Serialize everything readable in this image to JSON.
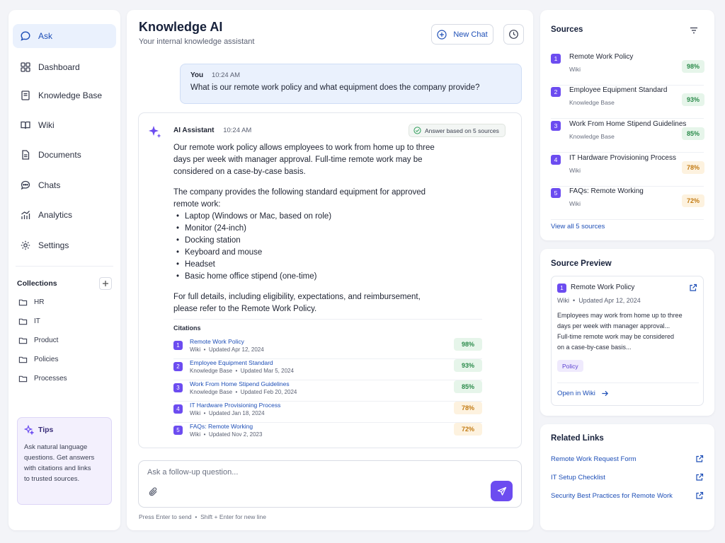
{
  "sidebar": {
    "nav": [
      {
        "label": "Ask",
        "icon": "chat-bubble-icon"
      },
      {
        "label": "Dashboard",
        "icon": "dashboard-icon"
      },
      {
        "label": "Knowledge Base",
        "icon": "book-icon"
      },
      {
        "label": "Wiki",
        "icon": "open-book-icon"
      },
      {
        "label": "Documents",
        "icon": "document-icon"
      },
      {
        "label": "Chats",
        "icon": "chat-icon"
      },
      {
        "label": "Analytics",
        "icon": "analytics-icon"
      },
      {
        "label": "Settings",
        "icon": "gear-icon"
      }
    ],
    "active_item": "Ask",
    "collections_title": "Collections",
    "collections": [
      "HR",
      "IT",
      "Product",
      "Policies",
      "Processes"
    ],
    "tips": {
      "title": "Tips",
      "line1": "Ask natural language",
      "line2": "questions. Get answers",
      "line3": "with citations and links",
      "line4": "to trusted sources."
    }
  },
  "header": {
    "title": "Knowledge AI",
    "subtitle": "Your internal knowledge assistant",
    "new_chat_label": "New Chat"
  },
  "user_message": {
    "author": "You",
    "time": "10:24 AM",
    "text": "What is our remote work policy and what equipment does the company provide?"
  },
  "ai_message": {
    "author": "AI Assistant",
    "time": "10:24 AM",
    "badge": "Answer based on 5 sources",
    "p1_l1": "Our remote work policy allows employees to work from home up to three",
    "p1_l2": "days per week with manager approval. Full-time remote work may be",
    "p1_l3": "considered on a case-by-case basis.",
    "p2_l1": "The company provides the following standard equipment for approved",
    "p2_l2": "remote work:",
    "equipment": [
      "Laptop (Windows or Mac, based on role)",
      "Monitor (24-inch)",
      "Docking station",
      "Keyboard and mouse",
      "Headset",
      "Basic home office stipend (one-time)"
    ],
    "p3_l1": "For full details, including eligibility, expectations, and reimbursement,",
    "p3_l2": "please refer to the Remote Work Policy.",
    "citations_title": "Citations",
    "citations": [
      {
        "num": "1",
        "title": "Remote Work Policy",
        "source": "Wiki",
        "updated": "Updated Apr 12, 2024",
        "score": "98%"
      },
      {
        "num": "2",
        "title": "Employee Equipment Standard",
        "source": "Knowledge Base",
        "updated": "Updated Mar 5, 2024",
        "score": "93%"
      },
      {
        "num": "3",
        "title": "Work From Home Stipend Guidelines",
        "source": "Knowledge Base",
        "updated": "Updated Feb 20, 2024",
        "score": "85%"
      },
      {
        "num": "4",
        "title": "IT Hardware Provisioning Process",
        "source": "Wiki",
        "updated": "Updated Jan 18, 2024",
        "score": "78%"
      },
      {
        "num": "5",
        "title": "FAQs: Remote Working",
        "source": "Wiki",
        "updated": "Updated Nov 2, 2023",
        "score": "72%"
      }
    ],
    "bullet_sep": "•"
  },
  "composer": {
    "placeholder": "Ask a follow-up question...",
    "hint_key1": "Press Enter",
    "hint_text1": "to send",
    "hint_key2": "Shift + Enter",
    "hint_text2": "for new line"
  },
  "sources_panel": {
    "title": "Sources",
    "items": [
      {
        "num": "1",
        "title": "Remote Work Policy",
        "source": "Wiki",
        "score": "98%"
      },
      {
        "num": "2",
        "title": "Employee Equipment Standard",
        "source": "Knowledge Base",
        "score": "93%"
      },
      {
        "num": "3",
        "title": "Work From Home Stipend Guidelines",
        "source": "Knowledge Base",
        "score": "85%"
      },
      {
        "num": "4",
        "title": "IT Hardware Provisioning Process",
        "source": "Wiki",
        "score": "78%"
      },
      {
        "num": "5",
        "title": "FAQs: Remote Working",
        "source": "Wiki",
        "score": "72%"
      }
    ],
    "view_all": "View all 5 sources"
  },
  "preview_panel": {
    "title": "Source Preview",
    "num": "1",
    "doc_title": "Remote Work Policy",
    "source": "Wiki",
    "updated": "Updated Apr 12, 2024",
    "l1": "Employees may work from home up to three",
    "l2": "days per week with manager approval...",
    "l3": "Full-time remote work may be considered",
    "l4": "on a case-by-case basis...",
    "tag": "Policy",
    "open_label": "Open in Wiki"
  },
  "related_panel": {
    "title": "Related Links",
    "links": [
      "Remote Work Request Form",
      "IT Setup Checklist",
      "Security Best Practices for Remote Work"
    ]
  },
  "colors": {
    "accent_purple": "#6c4cf0",
    "link_blue": "#1e4fb7",
    "score_green": "#2a8a4a",
    "score_orange": "#c27a12"
  }
}
